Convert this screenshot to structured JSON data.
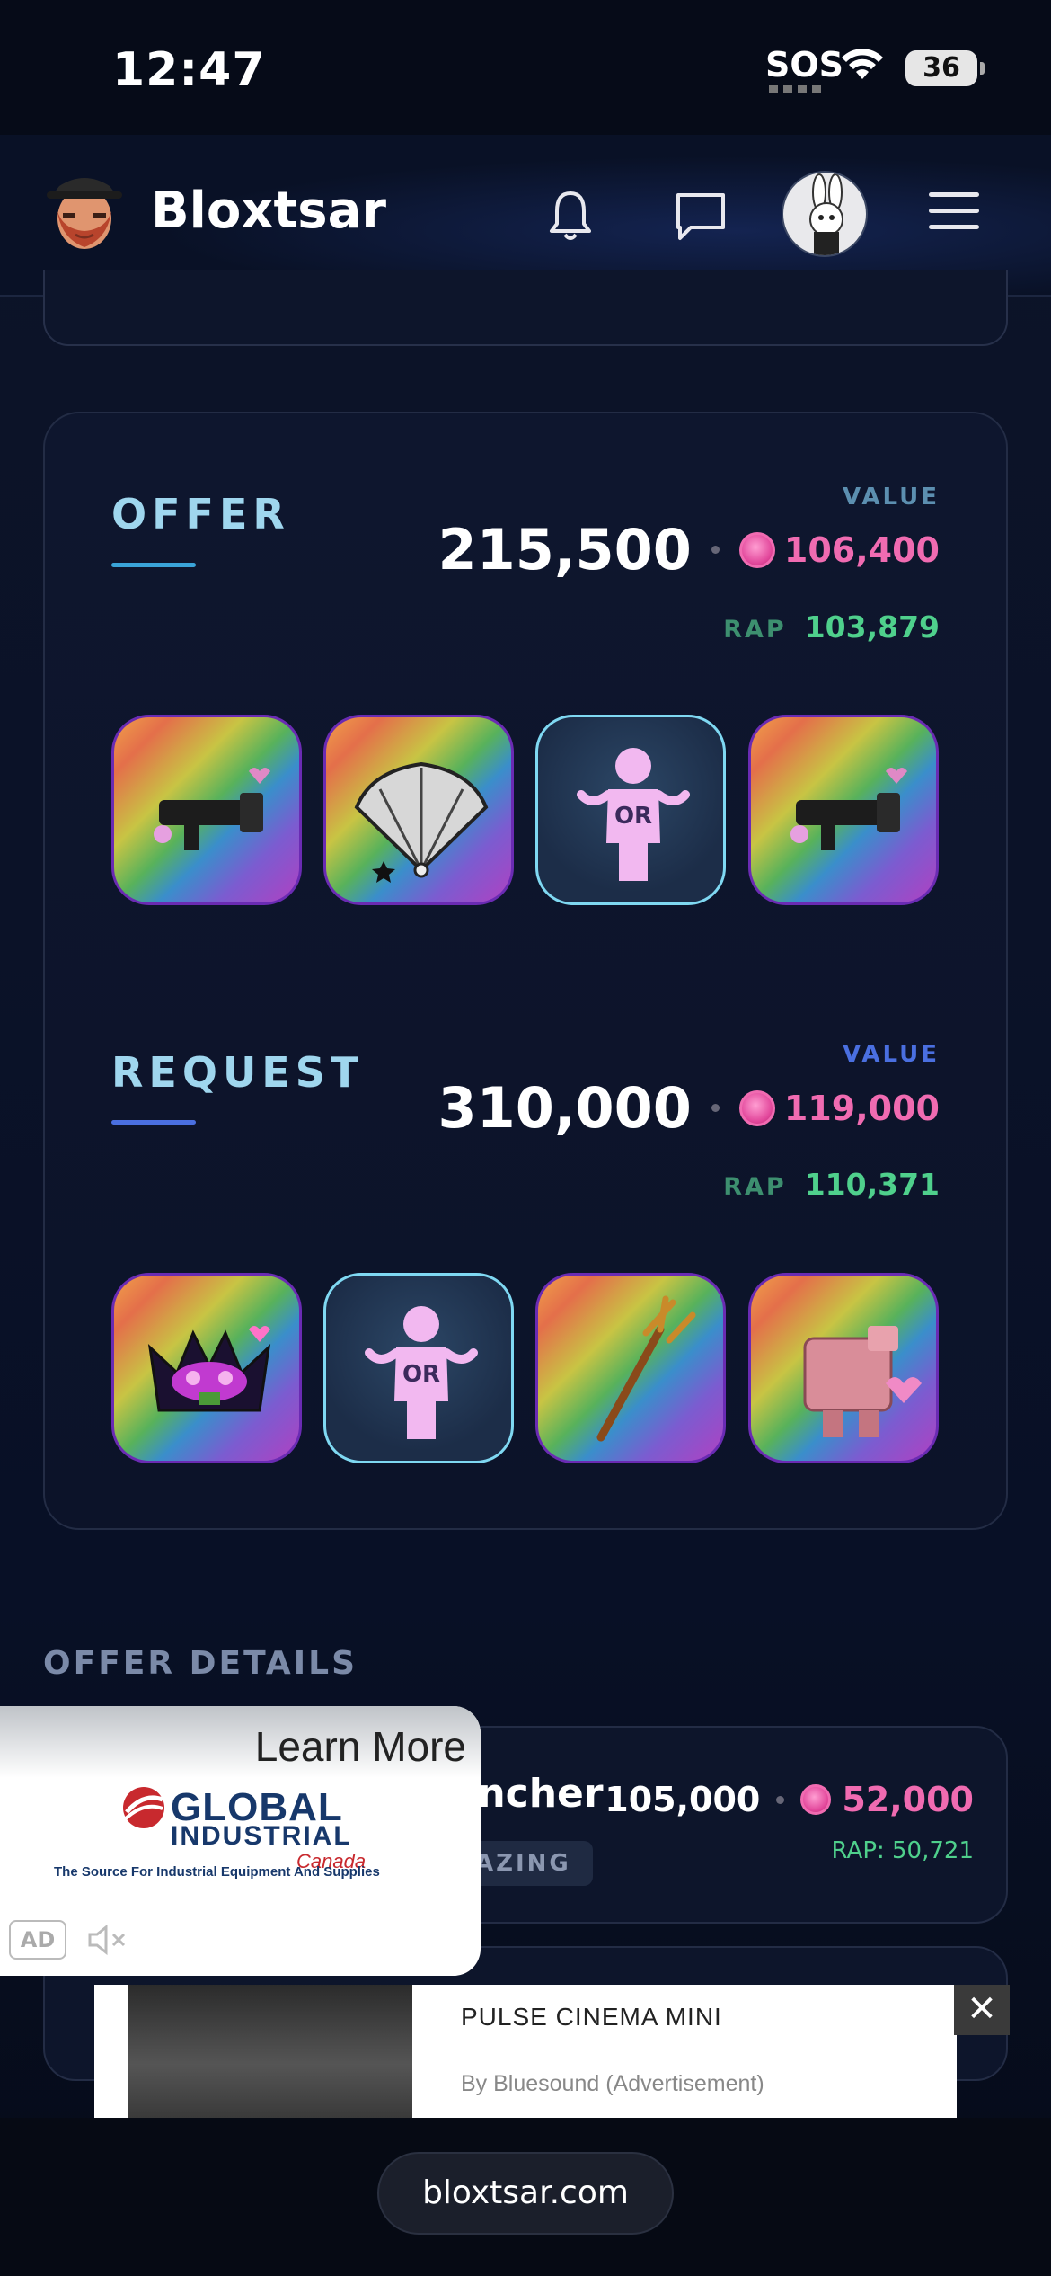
{
  "status": {
    "time": "12:47",
    "sos": "SOS",
    "battery": "36"
  },
  "header": {
    "brand": "Bloxtsar"
  },
  "offer": {
    "title": "OFFER",
    "value_label": "VALUE",
    "value": "215,500",
    "coin_value": "106,400",
    "rap_label": "RAP",
    "rap_value": "103,879",
    "items": [
      "rainbow-launcher-item",
      "rainbow-fan-item",
      "or-placeholder-item",
      "rainbow-launcher-item"
    ]
  },
  "request": {
    "title": "REQUEST",
    "value_label": "VALUE",
    "value": "310,000",
    "coin_value": "119,000",
    "rap_label": "RAP",
    "rap_value": "110,371",
    "items": [
      "rainbow-crown-item",
      "or-placeholder-item",
      "rainbow-trident-item",
      "rainbow-pig-item"
    ]
  },
  "or_label": "OR",
  "details": {
    "title": "OFFER DETAILS",
    "row": {
      "name": "uncher",
      "badge": "AZING",
      "value": "105,000",
      "coin_value": "52,000",
      "rap": "RAP: 50,721"
    }
  },
  "ad_popup": {
    "learn_more": "Learn More",
    "brand_line1": "GLOBAL",
    "brand_line2": "INDUSTRIAL",
    "brand_line3": "Canada",
    "tagline": "The Source For Industrial Equipment And Supplies",
    "ad_mark": "AD"
  },
  "banner_ad": {
    "title": "PULSE CINEMA MINI",
    "by": "By Bluesound (Advertisement)",
    "close": "✕"
  },
  "browser": {
    "url": "bloxtsar.com"
  },
  "colors": {
    "accent_cyan": "#9fd6ee",
    "coin_pink": "#f06bb1",
    "rap_green": "#4fd08c",
    "request_underline": "#4a6fe0",
    "offer_underline": "#3aa4d8"
  }
}
